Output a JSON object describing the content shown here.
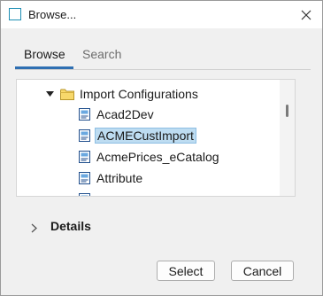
{
  "window": {
    "title": "Browse...",
    "accent_color": "#1e8fb4",
    "icons": {
      "app": "app-window-icon",
      "close": "close-icon"
    }
  },
  "tabs": [
    {
      "label": "Browse",
      "active": true
    },
    {
      "label": "Search",
      "active": false
    }
  ],
  "tree": {
    "folder": {
      "label": "Import Configurations",
      "expanded": true,
      "icon": "folder-icon"
    },
    "items": [
      {
        "label": "Acad2Dev",
        "selected": false,
        "icon": "import-config-icon"
      },
      {
        "label": "ACMECustImport",
        "selected": true,
        "icon": "import-config-icon"
      },
      {
        "label": "AcmePrices_eCatalog",
        "selected": false,
        "icon": "import-config-icon"
      },
      {
        "label": "Attribute",
        "selected": false,
        "icon": "import-config-icon"
      }
    ],
    "selection_color": "#bddcf1"
  },
  "details": {
    "label": "Details",
    "expanded": false
  },
  "buttons": {
    "select": "Select",
    "cancel": "Cancel"
  }
}
